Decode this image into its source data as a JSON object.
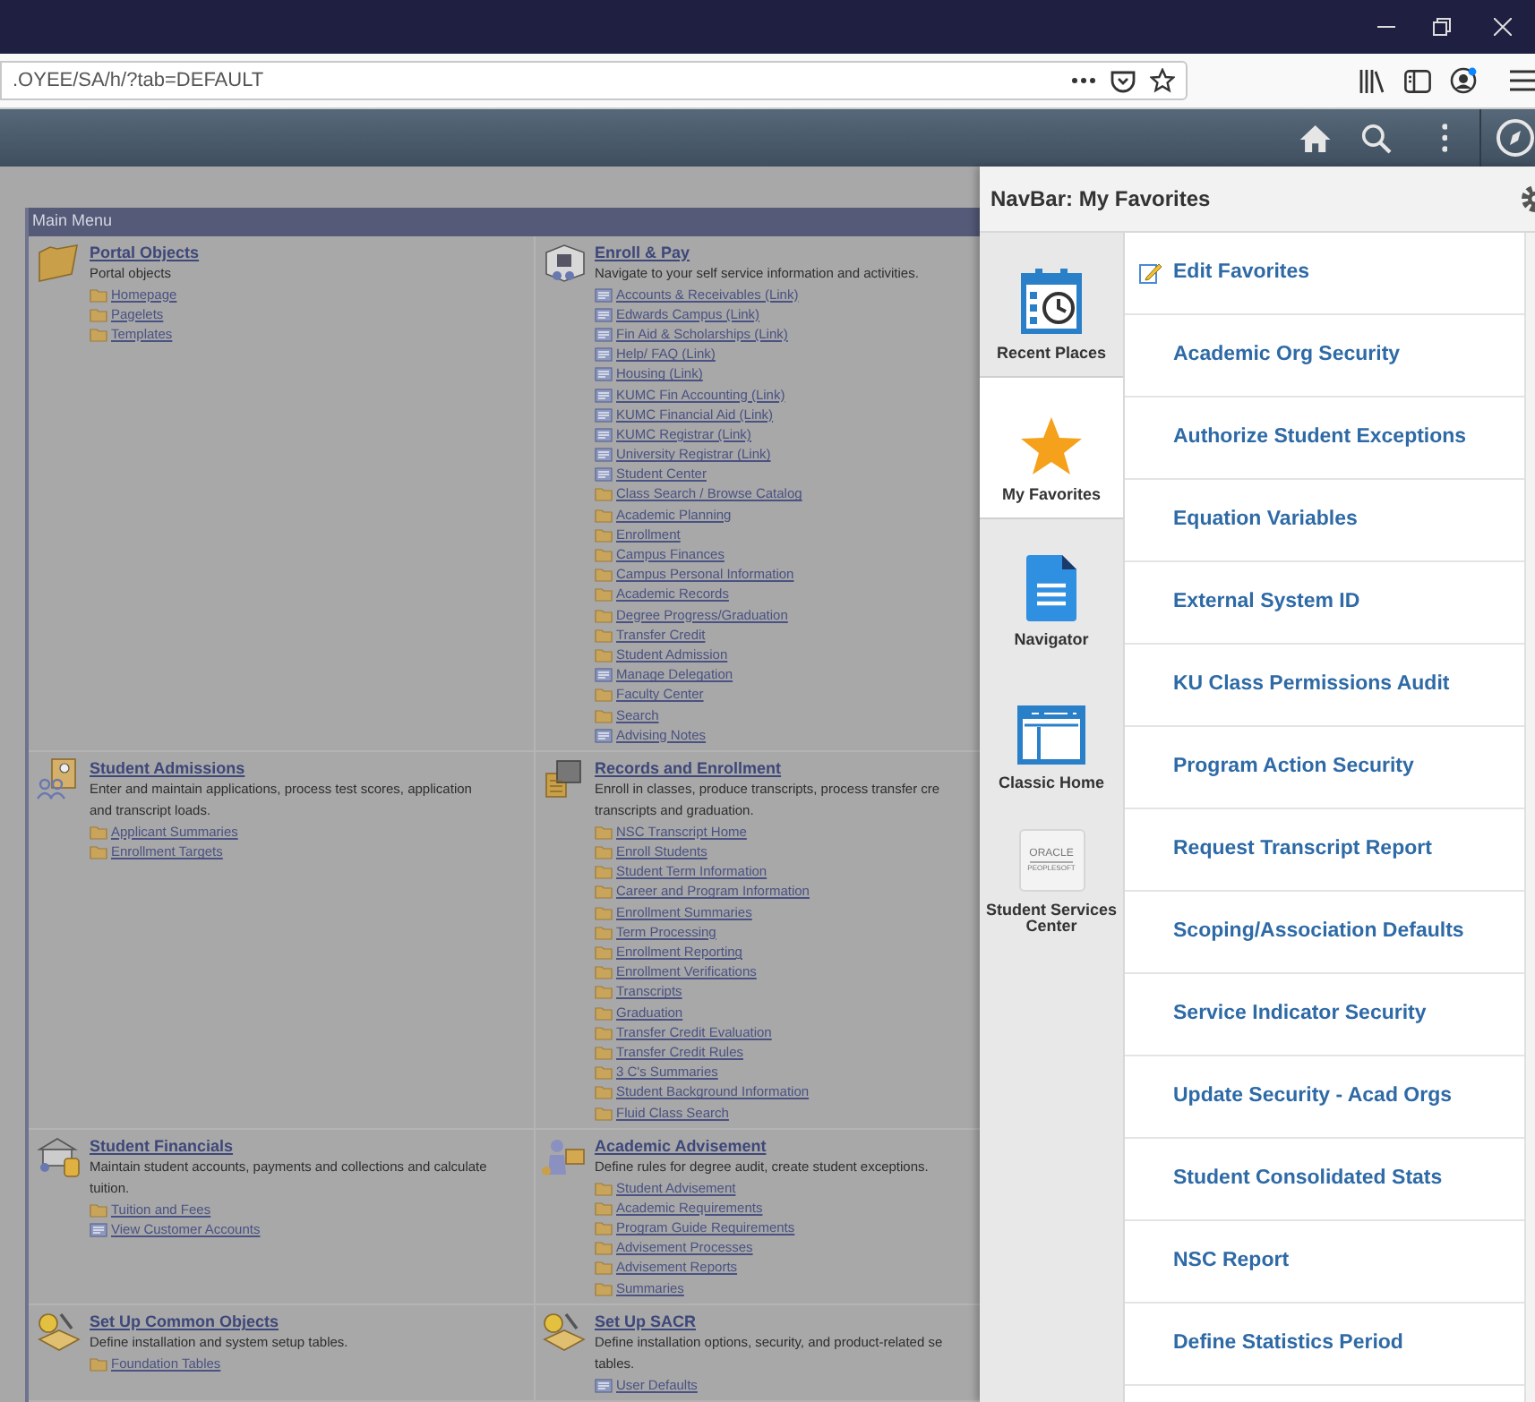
{
  "browser": {
    "url": ".OYEE/SA/h/?tab=DEFAULT"
  },
  "main_menu": {
    "title": "Main Menu",
    "sections": [
      {
        "title": "Portal Objects",
        "description_lines": [
          "Portal objects"
        ],
        "items": [
          {
            "label": "Homepage",
            "kind": "folder"
          },
          {
            "label": "Pagelets",
            "kind": "folder"
          },
          {
            "label": "Templates",
            "kind": "folder"
          }
        ]
      },
      {
        "title": "Enroll & Pay",
        "description_lines": [
          "Navigate to your self service information and activities."
        ],
        "items": [
          {
            "label": "Accounts & Receivables (Link)",
            "kind": "link"
          },
          {
            "label": "Edwards Campus (Link)",
            "kind": "link"
          },
          {
            "label": "Fin Aid & Scholarships (Link)",
            "kind": "link"
          },
          {
            "label": "Help/ FAQ (Link)",
            "kind": "link"
          },
          {
            "label": "Housing (Link)",
            "kind": "link"
          },
          {
            "label": "KUMC Fin Accounting (Link)",
            "kind": "link"
          },
          {
            "label": "KUMC Financial Aid (Link)",
            "kind": "link"
          },
          {
            "label": "KUMC Registrar (Link)",
            "kind": "link"
          },
          {
            "label": "University Registrar (Link)",
            "kind": "link"
          },
          {
            "label": "Student Center",
            "kind": "link"
          },
          {
            "label": "Class Search / Browse Catalog",
            "kind": "folder"
          },
          {
            "label": "Academic Planning",
            "kind": "folder"
          },
          {
            "label": "Enrollment",
            "kind": "folder"
          },
          {
            "label": "Campus Finances",
            "kind": "folder"
          },
          {
            "label": "Campus Personal Information",
            "kind": "folder"
          },
          {
            "label": "Academic Records",
            "kind": "folder"
          },
          {
            "label": "Degree Progress/Graduation",
            "kind": "folder"
          },
          {
            "label": "Transfer Credit",
            "kind": "folder"
          },
          {
            "label": "Student Admission",
            "kind": "folder"
          },
          {
            "label": "Manage Delegation",
            "kind": "link"
          },
          {
            "label": "Faculty Center",
            "kind": "folder"
          },
          {
            "label": "Search",
            "kind": "folder"
          },
          {
            "label": "Advising Notes",
            "kind": "link"
          }
        ]
      },
      {
        "title": "Student Admissions",
        "description_lines": [
          "Enter and maintain applications, process test scores, application",
          "and transcript loads."
        ],
        "items": [
          {
            "label": "Applicant Summaries",
            "kind": "folder"
          },
          {
            "label": "Enrollment Targets",
            "kind": "folder"
          }
        ]
      },
      {
        "title": "Records and Enrollment",
        "description_lines": [
          "Enroll in classes, produce transcripts, process transfer cre",
          "transcripts and graduation."
        ],
        "items": [
          {
            "label": "NSC Transcript Home",
            "kind": "folder"
          },
          {
            "label": "Enroll Students",
            "kind": "folder"
          },
          {
            "label": "Student Term Information",
            "kind": "folder"
          },
          {
            "label": "Career and Program Information",
            "kind": "folder"
          },
          {
            "label": "Enrollment Summaries",
            "kind": "folder"
          },
          {
            "label": "Term Processing",
            "kind": "folder"
          },
          {
            "label": "Enrollment Reporting",
            "kind": "folder"
          },
          {
            "label": "Enrollment Verifications",
            "kind": "folder"
          },
          {
            "label": "Transcripts",
            "kind": "folder"
          },
          {
            "label": "Graduation",
            "kind": "folder"
          },
          {
            "label": "Transfer Credit Evaluation",
            "kind": "folder"
          },
          {
            "label": "Transfer Credit Rules",
            "kind": "folder"
          },
          {
            "label": "3 C's Summaries",
            "kind": "folder"
          },
          {
            "label": "Student Background Information",
            "kind": "folder"
          },
          {
            "label": "Fluid Class Search",
            "kind": "folder"
          }
        ]
      },
      {
        "title": "Student Financials",
        "description_lines": [
          "Maintain student accounts, payments and collections and calculate",
          "tuition."
        ],
        "items": [
          {
            "label": "Tuition and Fees",
            "kind": "folder"
          },
          {
            "label": "View Customer Accounts",
            "kind": "link"
          }
        ]
      },
      {
        "title": "Academic Advisement",
        "description_lines": [
          "Define rules for degree audit, create student exceptions."
        ],
        "items": [
          {
            "label": "Student Advisement",
            "kind": "folder"
          },
          {
            "label": "Academic Requirements",
            "kind": "folder"
          },
          {
            "label": "Program Guide Requirements",
            "kind": "folder"
          },
          {
            "label": "Advisement Processes",
            "kind": "folder"
          },
          {
            "label": "Advisement Reports",
            "kind": "folder"
          },
          {
            "label": "Summaries",
            "kind": "folder"
          }
        ]
      },
      {
        "title": "Set Up Common Objects",
        "description_lines": [
          "Define installation and system setup tables."
        ],
        "items": [
          {
            "label": "Foundation Tables",
            "kind": "folder"
          }
        ]
      },
      {
        "title": "Set Up SACR",
        "description_lines": [
          "Define installation options, security, and product-related se",
          "tables."
        ],
        "items": [
          {
            "label": "User Defaults",
            "kind": "link"
          }
        ]
      }
    ]
  },
  "navbar": {
    "title": "NavBar: My Favorites",
    "tabs": [
      {
        "label": "Recent Places",
        "kind": "recent",
        "selected": false
      },
      {
        "label": "My Favorites",
        "kind": "favorites",
        "selected": true
      },
      {
        "label": "Navigator",
        "kind": "navigator",
        "selected": false
      },
      {
        "label": "Classic Home",
        "kind": "classic",
        "selected": false
      },
      {
        "label": "Student Services Center",
        "kind": "logo",
        "logo_lines": [
          "ORACLE",
          "PEOPLESOFT"
        ],
        "selected": false
      }
    ],
    "favorites": [
      {
        "label": "Edit Favorites",
        "kind": "edit"
      },
      {
        "label": "Academic Org Security",
        "kind": "link"
      },
      {
        "label": "Authorize Student Exceptions",
        "kind": "link"
      },
      {
        "label": "Equation Variables",
        "kind": "link"
      },
      {
        "label": "External System ID",
        "kind": "link"
      },
      {
        "label": "KU Class Permissions Audit",
        "kind": "link"
      },
      {
        "label": "Program Action Security",
        "kind": "link"
      },
      {
        "label": "Request Transcript Report",
        "kind": "link"
      },
      {
        "label": "Scoping/Association Defaults",
        "kind": "link"
      },
      {
        "label": "Service Indicator Security",
        "kind": "link"
      },
      {
        "label": "Update Security - Acad Orgs",
        "kind": "link"
      },
      {
        "label": "Student Consolidated Stats",
        "kind": "link"
      },
      {
        "label": "NSC Report",
        "kind": "link"
      },
      {
        "label": "Define Statistics Period",
        "kind": "link"
      }
    ]
  }
}
